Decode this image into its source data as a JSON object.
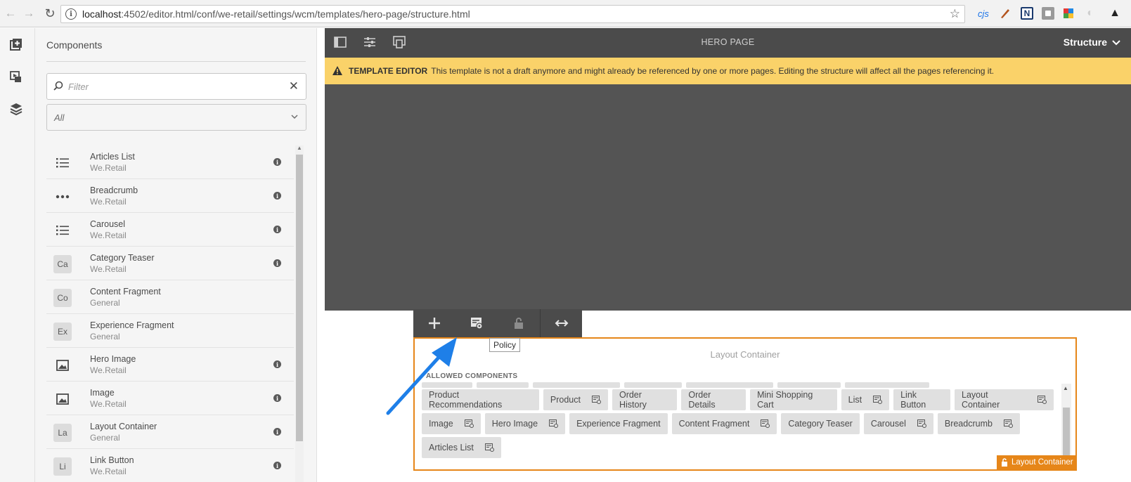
{
  "browser": {
    "url_host": "localhost",
    "url_rest": ":4502/editor.html/conf/we-retail/settings/wcm/templates/hero-page/structure.html",
    "extensions": [
      "cjs",
      "pen",
      "N",
      "square",
      "color",
      "ghost",
      "hat"
    ]
  },
  "panel": {
    "title": "Components",
    "filter_placeholder": "Filter",
    "group_select": "All",
    "items": [
      {
        "name": "Articles List",
        "group": "We.Retail",
        "icon": "list-icon",
        "abbr": "",
        "info": true
      },
      {
        "name": "Breadcrumb",
        "group": "We.Retail",
        "icon": "more-horizontal-icon",
        "abbr": "",
        "info": true
      },
      {
        "name": "Carousel",
        "group": "We.Retail",
        "icon": "list-icon",
        "abbr": "",
        "info": true
      },
      {
        "name": "Category Teaser",
        "group": "We.Retail",
        "icon": "",
        "abbr": "Ca",
        "info": true
      },
      {
        "name": "Content Fragment",
        "group": "General",
        "icon": "",
        "abbr": "Co",
        "info": false
      },
      {
        "name": "Experience Fragment",
        "group": "General",
        "icon": "",
        "abbr": "Ex",
        "info": false
      },
      {
        "name": "Hero Image",
        "group": "We.Retail",
        "icon": "image-icon",
        "abbr": "",
        "info": true
      },
      {
        "name": "Image",
        "group": "We.Retail",
        "icon": "image-icon",
        "abbr": "",
        "info": true
      },
      {
        "name": "Layout Container",
        "group": "General",
        "icon": "",
        "abbr": "La",
        "info": true
      },
      {
        "name": "Link Button",
        "group": "We.Retail",
        "icon": "",
        "abbr": "Li",
        "info": true
      }
    ]
  },
  "editor": {
    "page_title": "HERO PAGE",
    "mode": "Structure",
    "banner_label": "TEMPLATE EDITOR",
    "banner_text": "This template is not a draft anymore and might already be referenced by one or more pages. Editing the structure will affect all the pages referencing it.",
    "tooltip": "Policy",
    "layout_container": {
      "title": "Layout Container",
      "allowed_label": "ALLOWED COMPONENTS",
      "badge": "Layout Container",
      "rows": [
        [
          {
            "label": "Product Recommendations",
            "policy": false
          },
          {
            "label": "Product",
            "policy": true
          },
          {
            "label": "Order History",
            "policy": false
          },
          {
            "label": "Order Details",
            "policy": false
          },
          {
            "label": "Mini Shopping Cart",
            "policy": false
          },
          {
            "label": "List",
            "policy": true
          },
          {
            "label": "Link Button",
            "policy": false
          },
          {
            "label": "Layout Container",
            "policy": true
          }
        ],
        [
          {
            "label": "Image",
            "policy": true
          },
          {
            "label": "Hero Image",
            "policy": true
          },
          {
            "label": "Experience Fragment",
            "policy": false
          },
          {
            "label": "Content Fragment",
            "policy": true
          },
          {
            "label": "Category Teaser",
            "policy": false
          },
          {
            "label": "Carousel",
            "policy": true
          },
          {
            "label": "Breadcrumb",
            "policy": true
          }
        ],
        [
          {
            "label": "Articles List",
            "policy": true
          }
        ]
      ]
    }
  },
  "colors": {
    "accent": "#e68619",
    "banner": "#fad269",
    "arrow": "#1e7fe8"
  }
}
